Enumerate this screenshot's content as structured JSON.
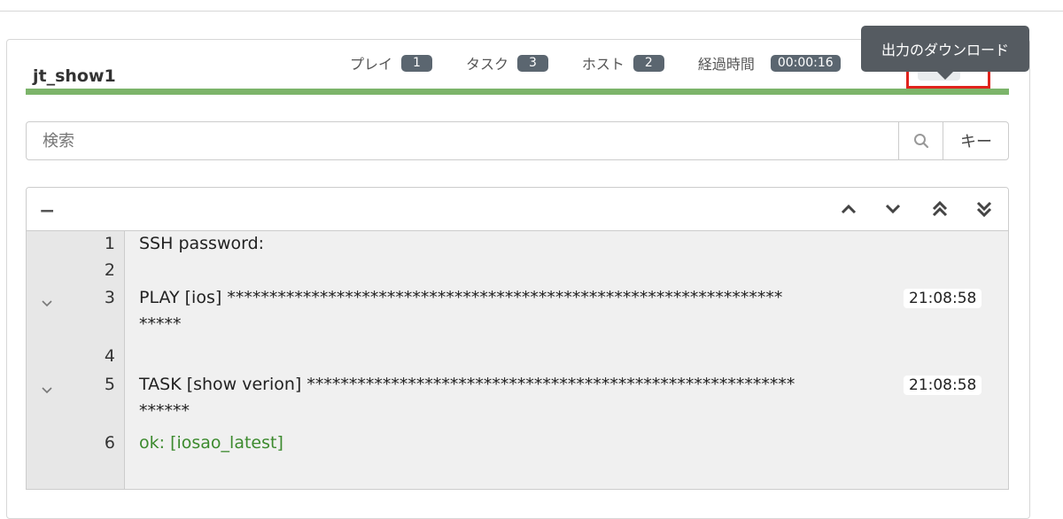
{
  "job": {
    "title": "jt_show1"
  },
  "stats": [
    {
      "label": "プレイ",
      "value": "1"
    },
    {
      "label": "タスク",
      "value": "3"
    },
    {
      "label": "ホスト",
      "value": "2"
    },
    {
      "label": "経過時間",
      "value": "00:00:16"
    }
  ],
  "toolbar": {
    "download_tooltip": "出力のダウンロード",
    "download_icon": "download-icon",
    "expand_icon": "expand-icon"
  },
  "progress": {
    "percent": 100,
    "color": "#7cb46a"
  },
  "search": {
    "placeholder": "検索",
    "key_button": "キー"
  },
  "output": {
    "collapse_all": "−",
    "lines": [
      {
        "num": "1",
        "text": "SSH password:",
        "type": "plain"
      },
      {
        "num": "2",
        "text": "",
        "type": "plain"
      },
      {
        "num": "3",
        "text": "PLAY [ios] ******************************************************************",
        "cont": "*****",
        "time": "21:08:58",
        "type": "play"
      },
      {
        "num": "4",
        "text": "",
        "type": "plain"
      },
      {
        "num": "5",
        "text": "TASK [show verion] **********************************************************",
        "cont": "******",
        "time": "21:08:58",
        "type": "task"
      },
      {
        "num": "6",
        "text": "ok: [iosao_latest]",
        "type": "ok"
      }
    ]
  }
}
